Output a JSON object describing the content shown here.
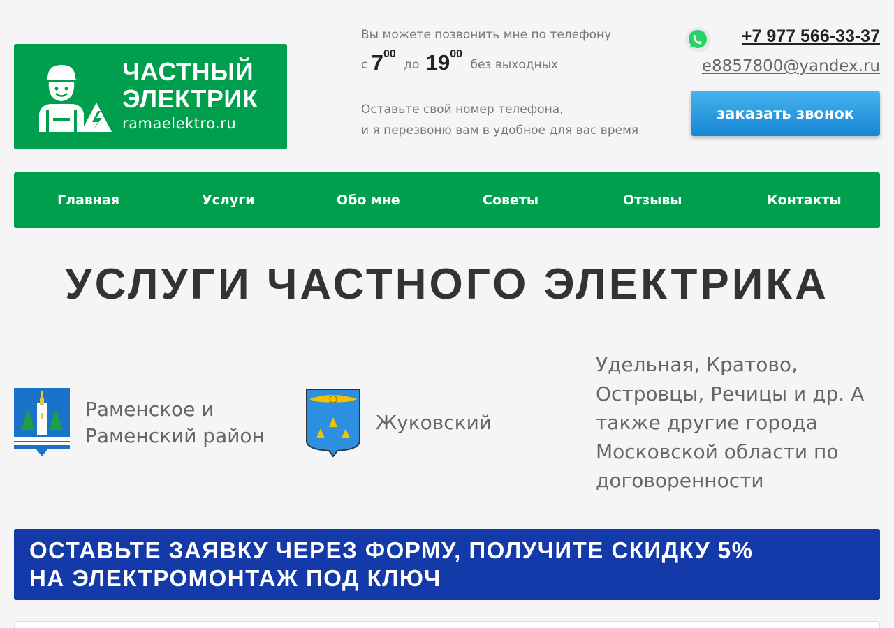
{
  "logo": {
    "title_line1": "ЧАСТНЫЙ",
    "title_line2": "ЭЛЕКТРИК",
    "site": "ramaelektro.ru",
    "icon": "electrician-icon"
  },
  "schedule": {
    "line1": "Вы можете позвонить мне по телефону",
    "from_word": "с",
    "from_hour": "7",
    "from_minutes": "00",
    "to_word": "до",
    "to_hour": "19",
    "to_minutes": "00",
    "days": "без выходных",
    "note_line1": "Оставьте свой номер телефона,",
    "note_line2": "и я перезвоню вам в удобное для вас время"
  },
  "contacts": {
    "whatsapp_icon": "whatsapp-icon",
    "phone": "+7 977 566-33-37",
    "email": "e8857800@yandex.ru",
    "callback_label": "заказать звонок"
  },
  "nav": {
    "items": [
      "Главная",
      "Услуги",
      "Обо мне",
      "Советы",
      "Отзывы",
      "Контакты"
    ]
  },
  "heading": "УСЛУГИ ЧАСТНОГО ЭЛЕКТРИКА",
  "cities": {
    "ramenskoe_line1": "Раменское и",
    "ramenskoe_line2": "Раменский район",
    "zhukovsky": "Жуковский",
    "others": "Удельная, Кратово, Островцы, Речицы и др. А также другие города Московской области по договоренности"
  },
  "banner": {
    "line1": "ОСТАВЬТЕ ЗАЯВКУ ЧЕРЕЗ ФОРМУ, ПОЛУЧИТЕ СКИДКУ 5%",
    "line2": "НА ЭЛЕКТРОМОНТАЖ ПОД КЛЮЧ"
  },
  "colors": {
    "brand_green": "#009f4d",
    "banner_blue": "#1439a8",
    "button_blue": "#1786d4"
  }
}
